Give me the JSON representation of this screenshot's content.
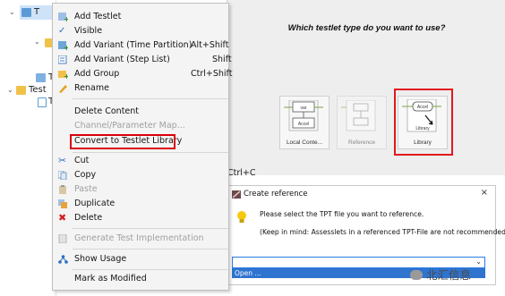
{
  "tree": {
    "items": [
      "T",
      "T",
      "Test",
      "T"
    ]
  },
  "menu": {
    "items": [
      {
        "label": "Add Testlet",
        "shortcut": ""
      },
      {
        "label": "Visible",
        "shortcut": ""
      },
      {
        "label": "Add  Variant (Time Partition)",
        "shortcut": "Alt+Shift"
      },
      {
        "label": "Add  Variant (Step List)",
        "shortcut": "Shift"
      },
      {
        "label": "Add Group",
        "shortcut": "Ctrl+Shift"
      },
      {
        "label": "Rename",
        "shortcut": ""
      },
      {
        "label": "Delete Content",
        "shortcut": ""
      },
      {
        "label": "Channel/Parameter Map...",
        "shortcut": ""
      },
      {
        "label": "Convert to Testlet Library",
        "shortcut": ""
      },
      {
        "label": "Cut",
        "shortcut": ""
      },
      {
        "label": "Copy",
        "shortcut": ""
      },
      {
        "label": "Paste",
        "shortcut": ""
      },
      {
        "label": "Duplicate",
        "shortcut": ""
      },
      {
        "label": "Delete",
        "shortcut": ""
      },
      {
        "label": "Generate Test Implementation",
        "shortcut": ""
      },
      {
        "label": "Show Usage",
        "shortcut": ""
      },
      {
        "label": "Mark as Modified",
        "shortcut": ""
      }
    ],
    "overflow_shortcut": "Ctrl+C"
  },
  "testlet_dialog": {
    "question": "Which testlet type do you want to use?",
    "options": [
      {
        "label": "Local Conte...",
        "top": "var",
        "bottom": "Accel"
      },
      {
        "label": "Reference",
        "top": "",
        "bottom": ""
      },
      {
        "label": "Library",
        "top": "Accel",
        "bottom": "Library"
      }
    ]
  },
  "reference_dialog": {
    "title": "Create reference",
    "close": "×",
    "message1": "Please select the TPT file you want to reference.",
    "message2": "(Keep in mind: Assesslets in a referenced TPT-File are not recommended)",
    "combo_value": "",
    "dropdown_option": "Open ..."
  },
  "watermark": "北汇信息",
  "colors": {
    "highlight_red": "#d9000d",
    "selection_blue": "#2f74cf",
    "menu_bg": "#f4f4f4"
  }
}
